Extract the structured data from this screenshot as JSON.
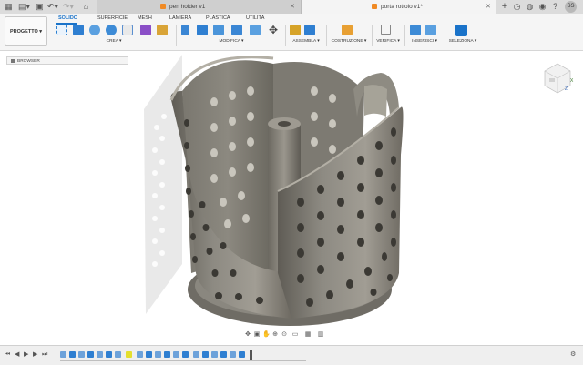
{
  "titlebar": {
    "tabs": [
      {
        "label": "pen holder v1",
        "close": "✕"
      },
      {
        "label": "porta rottolo v1*",
        "close": "✕"
      }
    ],
    "user_initials": "SS"
  },
  "ribbon": {
    "workspace": "PROGETTO ▾",
    "tabs": [
      "SOLIDO",
      "SUPERFICIE",
      "MESH",
      "LAMIERA",
      "PLASTICA",
      "UTILITÀ"
    ],
    "groups": [
      "CREA ▾",
      "MODIFICA ▾",
      "ASSEMBLA ▾",
      "COSTRUZIONE ▾",
      "VERIFICA ▾",
      "INSERISCI ▾",
      "SELEZIONA ▾"
    ]
  },
  "browser": {
    "label": "BROWSER"
  },
  "viewcube": {
    "x_label": "X",
    "z_label": "Z"
  },
  "colors": {
    "accent": "#1a73c9",
    "model_metal": "#8a877f",
    "doc_icon": "#f08a24"
  }
}
